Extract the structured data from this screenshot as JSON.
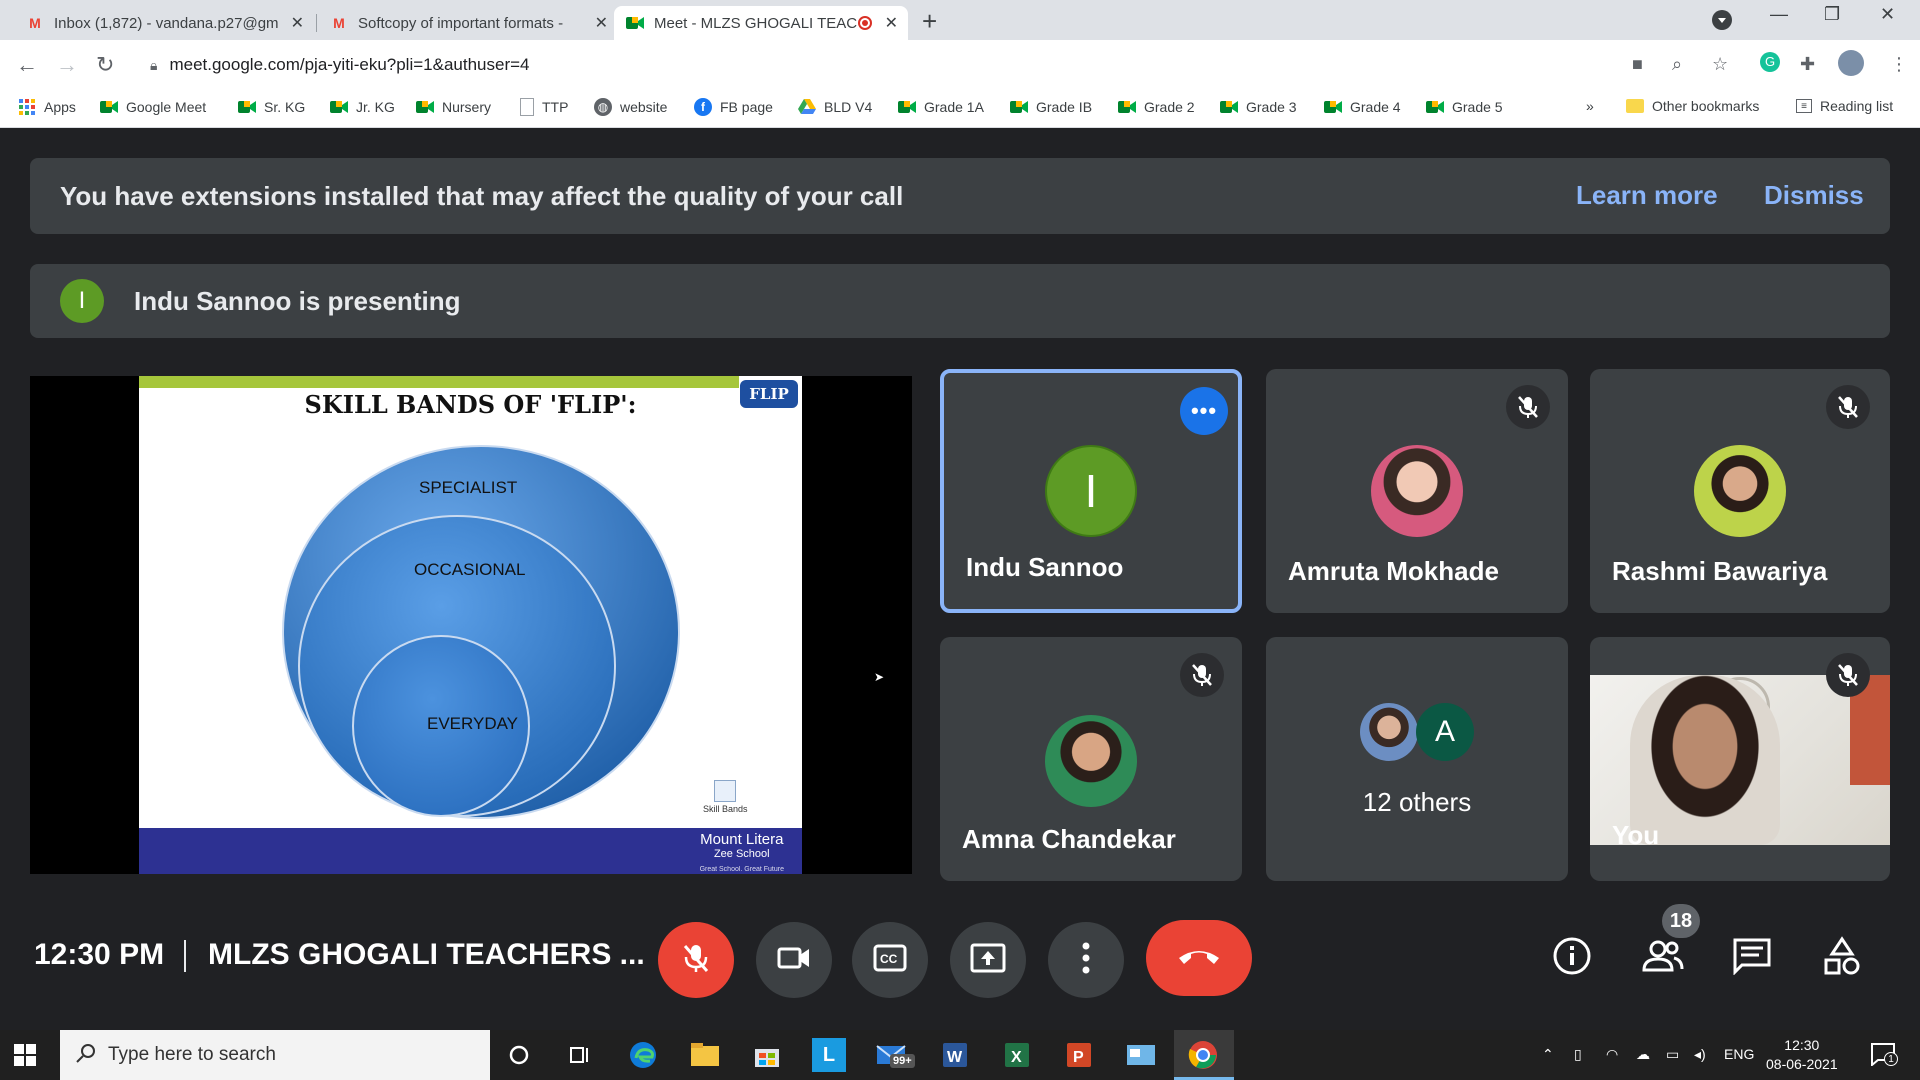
{
  "browser": {
    "tabs": [
      {
        "title": "Inbox (1,872) - vandana.p27@gm",
        "icon": "gmail-icon"
      },
      {
        "title": "Softcopy of important formats - ",
        "icon": "gmail-icon"
      },
      {
        "title": "Meet - MLZS GHOGALI TEAC",
        "icon": "meet-icon",
        "active": true
      }
    ],
    "url": "meet.google.com/pja-yiti-eku?pli=1&authuser=4",
    "bookmarks": [
      {
        "label": "Apps",
        "icon": "apps-grid-icon"
      },
      {
        "label": "Google Meet",
        "icon": "meet-icon"
      },
      {
        "label": "Sr. KG",
        "icon": "meet-icon"
      },
      {
        "label": "Jr. KG",
        "icon": "meet-icon"
      },
      {
        "label": "Nursery",
        "icon": "meet-icon"
      },
      {
        "label": "TTP",
        "icon": "document-icon"
      },
      {
        "label": "website",
        "icon": "globe-icon"
      },
      {
        "label": "FB page",
        "icon": "facebook-icon"
      },
      {
        "label": "BLD V4",
        "icon": "drive-icon"
      },
      {
        "label": "Grade 1A",
        "icon": "meet-icon"
      },
      {
        "label": "Grade IB",
        "icon": "meet-icon"
      },
      {
        "label": "Grade 2",
        "icon": "meet-icon"
      },
      {
        "label": "Grade 3",
        "icon": "meet-icon"
      },
      {
        "label": "Grade 4",
        "icon": "meet-icon"
      },
      {
        "label": "Grade 5",
        "icon": "meet-icon"
      }
    ],
    "overflow": "»",
    "other_bookmarks": "Other bookmarks",
    "reading_list": "Reading list"
  },
  "meet": {
    "banner": {
      "message": "You have extensions installed that may affect the quality of your call",
      "learn_more": "Learn more",
      "dismiss": "Dismiss"
    },
    "presenting": {
      "initial": "I",
      "text": "Indu Sannoo is presenting"
    },
    "slide": {
      "title": "SKILL BANDS OF 'FLIP':",
      "logo": "FLIP",
      "bands": [
        "SPECIALIST",
        "OCCASIONAL",
        "EVERYDAY"
      ],
      "icon_caption": "Skill Bands",
      "school_name": "Mount Litera",
      "school_sub": "Zee School",
      "tagline": "Great School. Great Future"
    },
    "participants": [
      {
        "name": "Indu Sannoo",
        "initial": "I",
        "avatar_color": "#5d9b25",
        "active": true
      },
      {
        "name": "Amruta Mokhade",
        "muted": true
      },
      {
        "name": "Rashmi Bawariya",
        "muted": true
      },
      {
        "name": "Amna Chandekar",
        "muted": true
      },
      {
        "name": "12 others",
        "extra_initial": "A",
        "extra_color": "#0b5844"
      },
      {
        "name": "You",
        "muted": true
      }
    ],
    "clock": "12:30 PM",
    "meeting_name": "MLZS GHOGALI TEACHERS ...",
    "participant_count": "18",
    "accent": "#8ab4f8",
    "end_call_color": "#ea4335"
  },
  "taskbar": {
    "search_placeholder": "Type here to search",
    "mail_badge": "99+",
    "language": "ENG",
    "time": "12:30",
    "date": "08-06-2021",
    "notification_count": "1"
  }
}
